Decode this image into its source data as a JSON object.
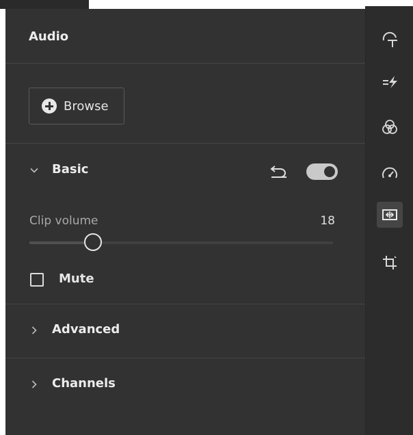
{
  "panel": {
    "title": "Audio"
  },
  "browse": {
    "label": "Browse",
    "icon": "plus-circle-icon"
  },
  "basic": {
    "label": "Basic",
    "expanded": true,
    "enabled": true,
    "clip_volume": {
      "label": "Clip volume",
      "value": "18",
      "level_fraction": 0.21
    },
    "mute": {
      "label": "Mute",
      "checked": false
    }
  },
  "advanced": {
    "label": "Advanced",
    "expanded": false
  },
  "channels": {
    "label": "Channels",
    "expanded": false
  },
  "rail": {
    "icons": [
      "text-icon",
      "speed-effects-icon",
      "color-icon",
      "speed-gauge-icon",
      "audio-icon",
      "crop-icon"
    ],
    "active": "audio-icon"
  },
  "colors": {
    "panel_bg": "#323232",
    "rail_bg": "#2c2c2c",
    "accent": "#c9c9c9"
  }
}
